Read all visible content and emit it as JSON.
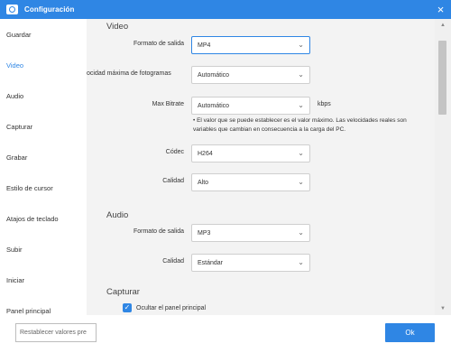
{
  "window": {
    "title": "Configuración",
    "close_icon": "×"
  },
  "sidebar": {
    "items": [
      {
        "label": "Guardar"
      },
      {
        "label": "Video"
      },
      {
        "label": "Audio"
      },
      {
        "label": "Capturar"
      },
      {
        "label": "Grabar"
      },
      {
        "label": "Estilo de cursor"
      },
      {
        "label": "Atajos de teclado"
      },
      {
        "label": "Subir"
      },
      {
        "label": "Iniciar"
      },
      {
        "label": "Panel principal"
      }
    ],
    "active": "Video"
  },
  "video": {
    "title": "Video",
    "format_label": "Formato de salida",
    "format_value": "MP4",
    "fps_label": "ocidad máxima de fotogramas",
    "fps_value": "Automático",
    "bitrate_label": "Max Bitrate",
    "bitrate_value": "Automático",
    "bitrate_unit": "kbps",
    "bitrate_note": "• El valor que se puede establecer es el valor máximo. Las velocidades reales son variables que cambian en consecuencia a la carga del PC.",
    "codec_label": "Códec",
    "codec_value": "H264",
    "quality_label": "Calidad",
    "quality_value": "Alto"
  },
  "audio": {
    "title": "Audio",
    "format_label": "Formato de salida",
    "format_value": "MP3",
    "quality_label": "Calidad",
    "quality_value": "Estándar"
  },
  "capture": {
    "title": "Capturar",
    "hide_panel_label": "Ocultar el panel principal",
    "hide_panel_checked": true
  },
  "footer": {
    "reset_label": "Restablecer valores pre",
    "ok_label": "Ok"
  },
  "colors": {
    "accent": "#2f86e4",
    "content_bg": "#f3f3f3"
  },
  "icons": {
    "dropdown": "chevron-down-icon",
    "check": "checkmark-icon",
    "app": "camera-icon"
  }
}
